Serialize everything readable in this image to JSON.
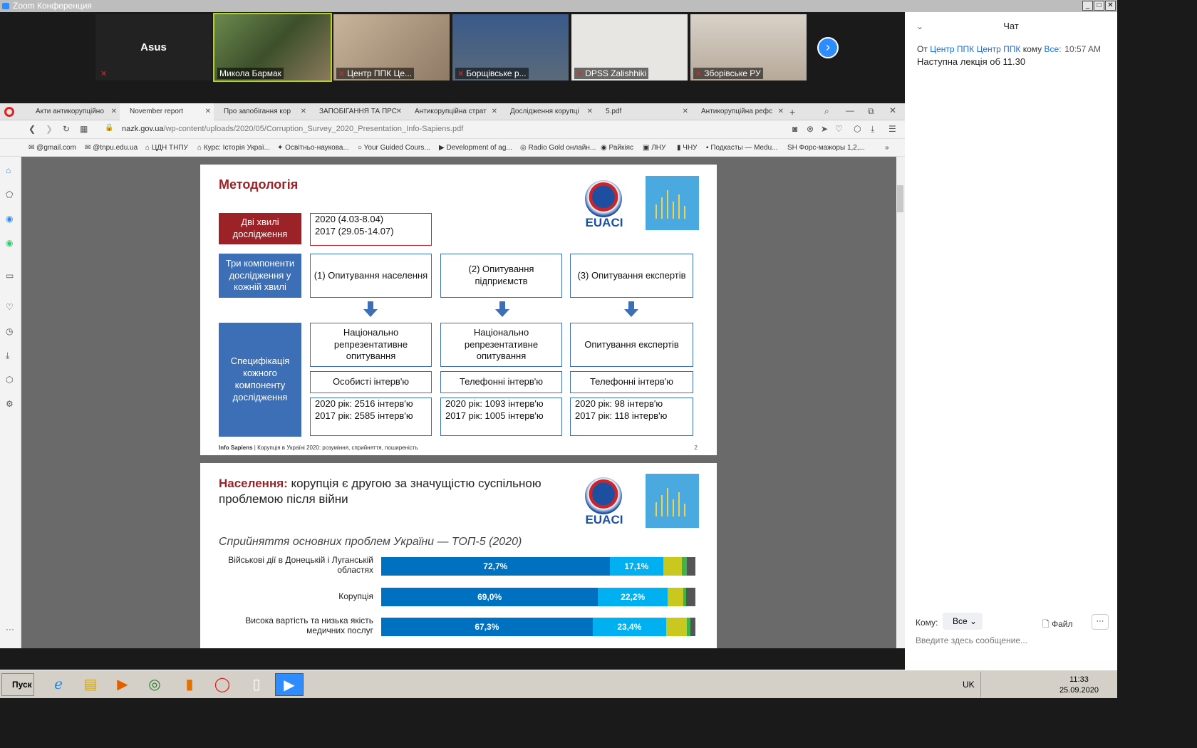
{
  "window": {
    "title": "Zoom Конференция"
  },
  "gallery": {
    "asus": "Asus",
    "p1": "Микола Бармак",
    "p2": "Центр ППК Це...",
    "p3": "Борщівське р...",
    "p4": "DPSS Zalishhiki",
    "p5": "Зборівське РУ"
  },
  "chat": {
    "title": "Чат",
    "from_label": "От",
    "from": "Центр ППК Центр ППК",
    "to_label": "кому",
    "to": "Все:",
    "time": "10:57 AM",
    "message": "Наступна лекція об 11.30",
    "recipient_label": "Кому:",
    "recipient": "Все",
    "file": "Файл",
    "placeholder": "Введите здесь сообщение..."
  },
  "tabs": [
    "Акти антикорупційно",
    "November report",
    "Про запобігання кор",
    "ЗАПОБІГАННЯ ТА ПРС",
    "Антикорупційна страт",
    "Дослідження корупці",
    "5.pdf",
    "Антикорупційна рефс"
  ],
  "url": {
    "host": "nazk.gov.ua",
    "path": "/wp-content/uploads/2020/05/Corruption_Survey_2020_Presentation_Info-Sapiens.pdf"
  },
  "bookmarks": [
    "@gmail.com",
    "@tnpu.edu.ua",
    "ЦДН ТНПУ",
    "Курс: Історія Украї...",
    "Освітньо-наукова...",
    "Your Guided Cours...",
    "Development of ag...",
    "Radio Gold онлайн...",
    "Райкіяс",
    "ЛНУ",
    "ЧНУ",
    "Подкасты — Medu...",
    "Форс-мажоры 1,2,..."
  ],
  "slide1": {
    "title": "Методологія",
    "logo": "EUACI",
    "waves_label": "Дві хвилі дослідження",
    "waves_1": "2020 (4.03-8.04)",
    "waves_2": "2017 (29.05-14.07)",
    "components_label": "Три компоненти дослідження у кожній хвилі",
    "spec_label": "Специфікація кожного компоненту дослідження",
    "c1": "(1) Опитування населення",
    "c2": "(2) Опитування підприємств",
    "c3": "(3) Опитування експертів",
    "s1": "Національно репрезентативне опитування",
    "s2": "Національно репрезентативне опитування",
    "s3": "Опитування експертів",
    "m1": "Особисті інтерв'ю",
    "m2": "Телефонні інтерв'ю",
    "m3": "Телефонні інтерв'ю",
    "n1a": "2020 рік: 2516 інтерв'ю",
    "n1b": "2017 рік: 2585 інтерв'ю",
    "n2a": "2020 рік: 1093 інтерв'ю",
    "n2b": "2017 рік: 1005 інтерв'ю",
    "n3a": "2020 рік: 98 інтерв'ю",
    "n3b": "2017 рік: 118 інтерв'ю",
    "footer_brand": "Info Sapiens",
    "footer_text": " | Корупція в Україні 2020: розуміння, сприйняття, поширеність",
    "page": "2"
  },
  "slide2": {
    "title_bold": "Населення:",
    "title_rest": " корупція є другою за значущістю суспільною проблемою після війни",
    "subtitle": "Сприйняття основних проблем України — ТОП-5 (2020)"
  },
  "chart_data": {
    "type": "bar",
    "categories": [
      "Військові дії в Донецькій і Луганській областях",
      "Корупція",
      "Висока вартість та низька якість медичних послуг"
    ],
    "series": [
      {
        "values": [
          72.7,
          69.0,
          67.3
        ],
        "color": "#0070c0",
        "labels": [
          "72,7%",
          "69,0%",
          "67,3%"
        ]
      },
      {
        "values": [
          17.1,
          22.2,
          23.4
        ],
        "color": "#00b0f0",
        "labels": [
          "17,1%",
          "22,2%",
          "23,4%"
        ]
      },
      {
        "values": [
          6.0,
          5.0,
          6.5
        ],
        "color": "#c8c81e"
      },
      {
        "values": [
          1.5,
          0.8,
          1.2
        ],
        "color": "#3ab54a"
      },
      {
        "values": [
          2.7,
          3.0,
          1.6
        ],
        "color": "#555555"
      }
    ]
  },
  "taskbar": {
    "start": "Пуск",
    "lang": "UK",
    "time": "11:33",
    "date": "25.09.2020"
  }
}
